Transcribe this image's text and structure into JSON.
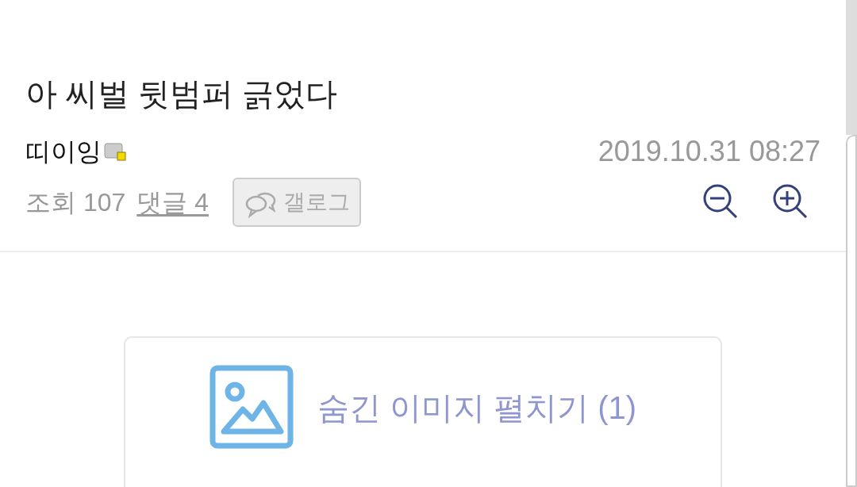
{
  "post": {
    "title": "아 씨벌 뒷범퍼 긁었다",
    "author": "띠이잉",
    "date": "2019.10.31 08:27",
    "views_label": "조회 107",
    "comments_link": "댓글 4",
    "gallog_button": "갤로그"
  },
  "hidden_images": {
    "label": "숨긴 이미지 펼치기 (1)"
  }
}
